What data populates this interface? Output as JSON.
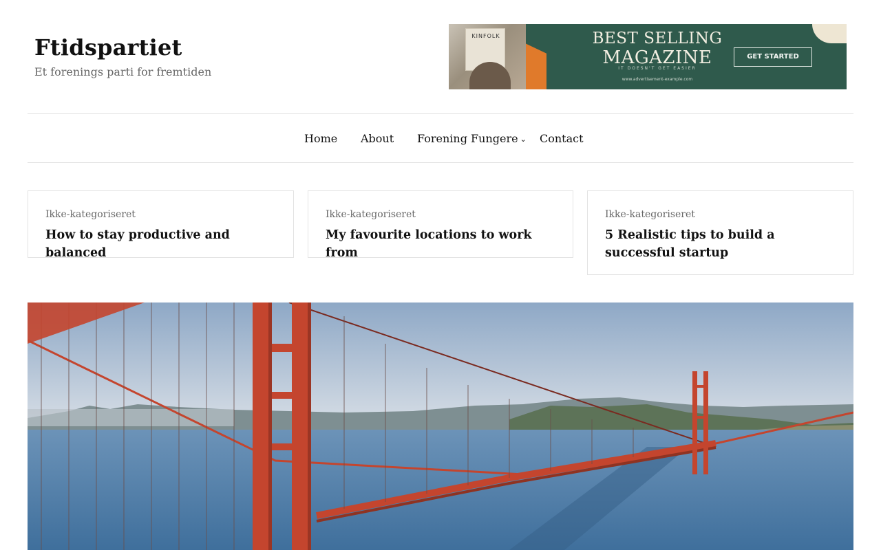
{
  "site": {
    "title": "Ftidspartiet",
    "tagline": "Et forenings parti for fremtiden"
  },
  "ad": {
    "book_label": "KINFOLK",
    "title_line1": "BEST SELLING",
    "title_line2": "MAGAZINE",
    "subtitle": "IT DOESN'T GET EASIER",
    "url": "www.advertisement-example.com",
    "cta": "GET STARTED",
    "colors": {
      "background": "#2f5a4c",
      "accent": "#e07a2b"
    }
  },
  "nav": {
    "items": [
      {
        "label": "Home"
      },
      {
        "label": "About"
      },
      {
        "label": "Forening Fungere",
        "has_dropdown": true
      },
      {
        "label": "Contact"
      }
    ],
    "dropdown_icon": "chevron-down-icon"
  },
  "posts": [
    {
      "category": "Ikke-kategoriseret",
      "title": "How to stay productive and balanced"
    },
    {
      "category": "Ikke-kategoriseret",
      "title": "My favourite locations to work from"
    },
    {
      "category": "Ikke-kategoriseret",
      "title": "5 Realistic tips to build a successful startup"
    }
  ],
  "hero": {
    "image": "golden-gate-bridge-photo",
    "colors": {
      "sky": "#aebfd4",
      "water": "#4f7ea6",
      "bridge": "#c4452e"
    }
  }
}
